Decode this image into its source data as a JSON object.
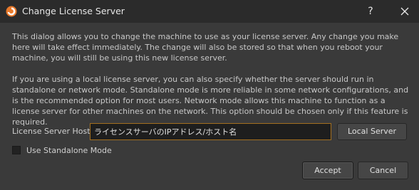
{
  "window": {
    "title": "Change License Server",
    "help_glyph": "?",
    "icon": "houdini-app-icon"
  },
  "body": {
    "paragraph1": "This dialog allows you to change the machine to use as your license server.  Any change you make here will take effect immediately.  The change will also be stored so that when you reboot your machine, you will still be using this new license server.",
    "paragraph2": "If you are using a local license server, you can also specify whether the server should run in standalone or network mode. Standalone mode is more reliable in some network configurations, and is the recommended option for most users.  Network mode allows this machine to function as a license server for other machines on the network.  This option should be chosen only if this feature is required."
  },
  "host": {
    "label": "License Server Host:",
    "value": "ライセンスサーバのIPアドレス/ホスト名",
    "local_server_label": "Local Server"
  },
  "standalone": {
    "label": "Use Standalone Mode",
    "checked": false
  },
  "buttons": {
    "accept": "Accept",
    "cancel": "Cancel"
  },
  "colors": {
    "background": "#3a3a3a",
    "titlebar": "#2b2b2b",
    "input_focus_border": "#a36f1f",
    "icon_orange": "#e8792b"
  }
}
